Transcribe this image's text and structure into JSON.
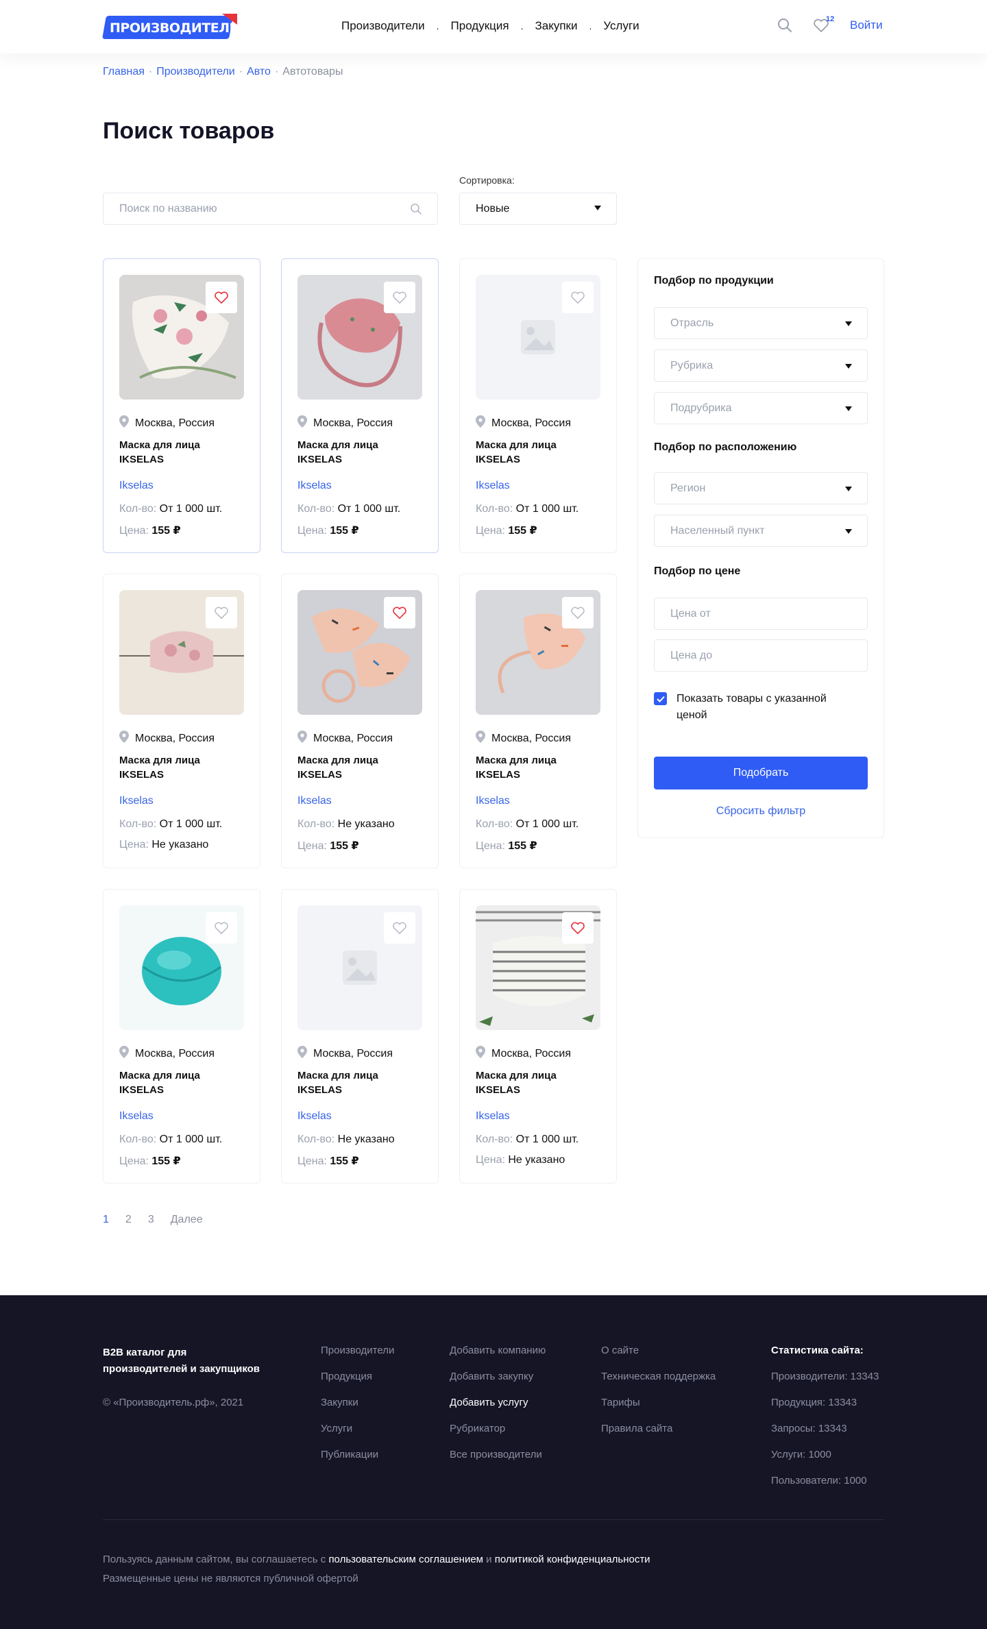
{
  "header": {
    "logo_text": "ПРОИЗВОДИТЕЛЬ.РФ",
    "nav": [
      "Производители",
      "Продукция",
      "Закупки",
      "Услуги"
    ],
    "nav_separator": ".",
    "favorites_count": "12",
    "login_label": "Войти",
    "icons": {
      "search": "search-icon",
      "favorites": "heart-icon"
    }
  },
  "breadcrumb": [
    "Главная",
    "Производители",
    "Авто",
    "Автотовары"
  ],
  "breadcrumb_separator": "·",
  "page_title": "Поиск товаров",
  "search": {
    "placeholder": "Поиск по названию",
    "value": ""
  },
  "sort": {
    "label": "Сортировка:",
    "value": "Новые"
  },
  "card_labels": {
    "qty": "Кол-во:",
    "price": "Цена:"
  },
  "products": [
    {
      "image": "floral-mask-photo",
      "favorite": true,
      "location": "Москва, Россия",
      "title": "Маска для лица IKSELAS",
      "brand": "Ikselas",
      "qty": "От 1 000 шт.",
      "price": "155 ₽",
      "price_bold": true,
      "highlighted": true
    },
    {
      "image": "pink-mask-photo",
      "favorite": false,
      "location": "Москва, Россия",
      "title": "Маска для лица IKSELAS",
      "brand": "Ikselas",
      "qty": "От 1 000 шт.",
      "price": "155 ₽",
      "price_bold": true,
      "highlighted": true
    },
    {
      "image": "placeholder-image",
      "favorite": false,
      "location": "Москва, Россия",
      "title": "Маска для лица IKSELAS",
      "brand": "Ikselas",
      "qty": "От 1 000 шт.",
      "price": "155 ₽",
      "price_bold": true,
      "highlighted": false
    },
    {
      "image": "rose-mask-photo",
      "favorite": false,
      "location": "Москва, Россия",
      "title": "Маска для лица IKSELAS",
      "brand": "Ikselas",
      "qty": "От 1 000 шт.",
      "price": "Не указано",
      "price_bold": false,
      "highlighted": false
    },
    {
      "image": "sprinkle-masks-photo",
      "favorite": true,
      "location": "Москва, Россия",
      "title": "Маска для лица IKSELAS",
      "brand": "Ikselas",
      "qty": "Не указано",
      "price": "155 ₽",
      "price_bold": true,
      "highlighted": false
    },
    {
      "image": "sprinkle-mask-photo",
      "favorite": false,
      "location": "Москва, Россия",
      "title": "Маска для лица IKSELAS",
      "brand": "Ikselas",
      "qty": "От 1 000 шт.",
      "price": "155 ₽",
      "price_bold": true,
      "highlighted": false
    },
    {
      "image": "turquoise-respirator-photo",
      "favorite": false,
      "location": "Москва, Россия",
      "title": "Маска для лица IKSELAS",
      "brand": "Ikselas",
      "qty": "От 1 000 шт.",
      "price": "155 ₽",
      "price_bold": true,
      "highlighted": false
    },
    {
      "image": "placeholder-image",
      "favorite": false,
      "location": "Москва, Россия",
      "title": "Маска для лица IKSELAS",
      "brand": "Ikselas",
      "qty": "Не указано",
      "price": "155 ₽",
      "price_bold": true,
      "highlighted": false
    },
    {
      "image": "striped-mask-photo",
      "favorite": true,
      "location": "Москва, Россия",
      "title": "Маска для лица IKSELAS",
      "brand": "Ikselas",
      "qty": "От 1 000 шт.",
      "price": "Не указано",
      "price_bold": false,
      "highlighted": false
    }
  ],
  "filter": {
    "products_heading": "Подбор по продукции",
    "industry": "Отрасль",
    "category": "Рубрика",
    "subcategory": "Подрубрика",
    "location_heading": "Подбор по расположению",
    "region": "Регион",
    "locality": "Населенный пункт",
    "price_heading": "Подбор по цене",
    "price_from": "Цена от",
    "price_to": "Цена до",
    "with_price_label": "Показать товары с указанной ценой",
    "with_price_checked": true,
    "apply": "Подобрать",
    "reset": "Сбросить фильтр"
  },
  "pagination": {
    "pages": [
      "1",
      "2",
      "3"
    ],
    "current": "1",
    "next": "Далее"
  },
  "footer": {
    "about": "B2B каталог для производителей и закупщиков",
    "copyright": "© «Производитель.рф», 2021",
    "col1": [
      "Производители",
      "Продукция",
      "Закупки",
      "Услуги",
      "Публикации"
    ],
    "col2": [
      "Добавить компанию",
      "Добавить закупку",
      "Добавить услугу",
      "Рубрикатор",
      "Все производители"
    ],
    "col2_highlight": "Добавить услугу",
    "col3": [
      "О сайте",
      "Техническая поддержка",
      "Тарифы",
      "Правила сайта"
    ],
    "stats_title": "Статистика сайта:",
    "stats": [
      "Производители: 13343",
      "Продукция: 13343",
      "Запросы: 13343",
      "Услуги: 1000",
      "Пользователи: 1000"
    ],
    "legal_prefix": "Пользуясь данным сайтом, вы соглашаетесь с",
    "legal_link1": "пользовательским соглашением",
    "legal_and": "и",
    "legal_link2": "политикой конфиденциальности",
    "legal_line2": "Размещенные цены не являются публичной офертой"
  },
  "colors": {
    "accent": "#2f5cf5",
    "link": "#3763e6",
    "heart_active": "#e8323c",
    "footer_bg": "#161526"
  }
}
